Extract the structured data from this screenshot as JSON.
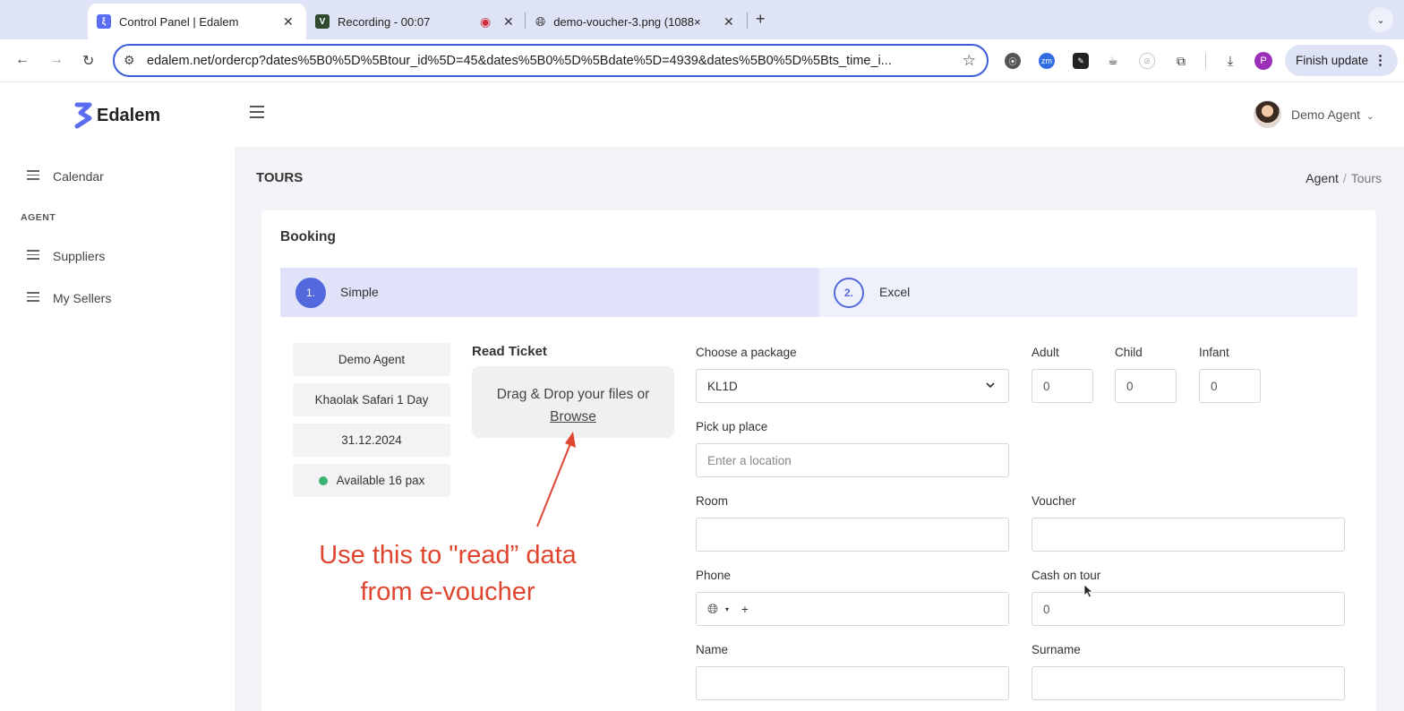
{
  "browser": {
    "tabs": [
      {
        "title": "Control Panel | Edalem",
        "active": true
      },
      {
        "title": "Recording - 00:07",
        "active": false
      },
      {
        "title": "demo-voucher-3.png (1088×",
        "active": false
      }
    ],
    "url": "edalem.net/ordercp?dates%5B0%5D%5Btour_id%5D=45&dates%5B0%5D%5Bdate%5D=4939&dates%5B0%5D%5Bts_time_i...",
    "profile_initial": "P",
    "finish_update": "Finish update"
  },
  "app": {
    "brand": "Edalem",
    "user_name": "Demo Agent"
  },
  "sidebar": {
    "top_item": "Calendar",
    "section": "AGENT",
    "items": [
      "Suppliers",
      "My Sellers"
    ]
  },
  "page": {
    "title": "TOURS",
    "breadcrumb": [
      "Agent",
      "Tours"
    ]
  },
  "booking": {
    "title": "Booking",
    "steps": [
      {
        "num": "1.",
        "label": "Simple"
      },
      {
        "num": "2.",
        "label": "Excel"
      }
    ],
    "info": {
      "agent": "Demo Agent",
      "tour": "Khaolak Safari 1 Day",
      "date": "31.12.2024",
      "availability": "Available 16 pax"
    },
    "read_ticket": {
      "title": "Read Ticket",
      "drop_text": "Drag & Drop your files or",
      "browse": "Browse"
    },
    "form": {
      "package_label": "Choose a package",
      "package_value": "KL1D",
      "adult_label": "Adult",
      "adult_value": "0",
      "child_label": "Child",
      "child_value": "0",
      "infant_label": "Infant",
      "infant_value": "0",
      "pickup_label": "Pick up place",
      "pickup_placeholder": "Enter a location",
      "room_label": "Room",
      "room_value": "",
      "voucher_label": "Voucher",
      "voucher_value": "",
      "phone_label": "Phone",
      "phone_prefix": "+",
      "cash_label": "Cash on tour",
      "cash_value": "0",
      "name_label": "Name",
      "name_value": "",
      "surname_label": "Surname",
      "surname_value": ""
    }
  },
  "annotation": {
    "line1": "Use this to \"read” data",
    "line2": "from e-voucher",
    "color": "#e0452f"
  }
}
